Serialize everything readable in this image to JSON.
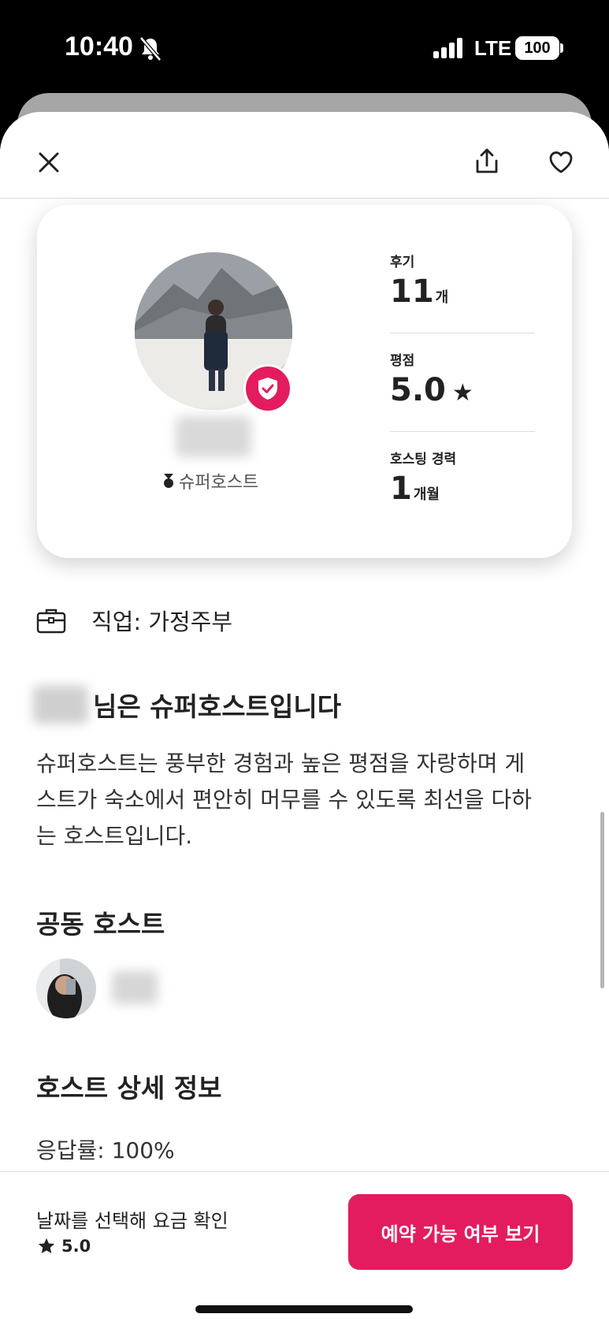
{
  "status_bar": {
    "time": "10:40",
    "network": "LTE",
    "battery": "100"
  },
  "host_card": {
    "superhost_label": "슈퍼호스트",
    "stats": [
      {
        "label": "후기",
        "value": "11",
        "unit": "개"
      },
      {
        "label": "평점",
        "value": "5.0",
        "unit": "★"
      },
      {
        "label": "호스팅 경력",
        "value": "1",
        "unit": "개월"
      }
    ]
  },
  "job": "직업: 가정주부",
  "superhost_section": {
    "heading_suffix": "님은 슈퍼호스트입니다",
    "description": "슈퍼호스트는 풍부한 경험과 높은 평점을 자랑하며 게스트가 숙소에서 편안히 머무를 수 있도록 최선을 다하는 호스트입니다."
  },
  "cohost": {
    "heading": "공동 호스트"
  },
  "host_details": {
    "heading": "호스트 상세 정보",
    "response_rate": "응답률: 100%"
  },
  "footer": {
    "price_hint": "날짜를 선택해 요금 확인",
    "rating": "5.0",
    "reserve_label": "예약 가능 여부 보기"
  },
  "colors": {
    "accent": "#e31c5f"
  }
}
